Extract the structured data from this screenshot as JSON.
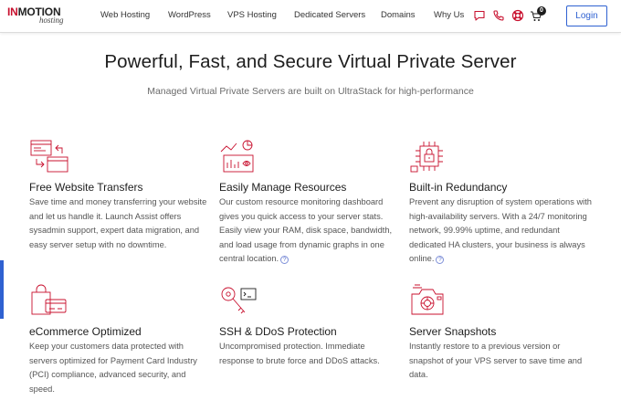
{
  "brand": {
    "logo_main": "INMOTION",
    "logo_in": "IN",
    "logo_rest": "MOTION",
    "logo_sub": "hosting",
    "accent": "#c8102e",
    "link_blue": "#2f61d1"
  },
  "nav": {
    "items": [
      {
        "label": "Web Hosting"
      },
      {
        "label": "WordPress"
      },
      {
        "label": "VPS Hosting"
      },
      {
        "label": "Dedicated Servers"
      },
      {
        "label": "Domains"
      },
      {
        "label": "Why Us"
      }
    ],
    "icons": [
      "chat-icon",
      "phone-icon",
      "lifebuoy-icon",
      "cart-icon"
    ],
    "cart_count": "0",
    "login_label": "Login"
  },
  "hero": {
    "title": "Powerful, Fast, and Secure Virtual Private Server",
    "subtitle": "Managed Virtual Private Servers are built on UltraStack for high-performance"
  },
  "features": [
    {
      "title": "Free Website Transfers",
      "desc": "Save time and money transferring your website and let us handle it. Launch Assist offers sysadmin support, expert data migration, and easy server setup with no downtime.",
      "icon": "website-transfer-icon",
      "help": false
    },
    {
      "title": "Easily Manage Resources",
      "desc": "Our custom resource monitoring dashboard gives you quick access to your server stats. Easily view your RAM, disk space, bandwidth, and load usage from dynamic graphs in one central location.",
      "icon": "resource-graph-icon",
      "help": true
    },
    {
      "title": "Built-in Redundancy",
      "desc": "Prevent any disruption of system operations with high-availability servers. With a 24/7 monitoring network, 99.99% uptime, and redundant dedicated HA clusters, your business is always online.",
      "icon": "redundancy-chip-icon",
      "help": true
    },
    {
      "title": "eCommerce Optimized",
      "desc": "Keep your customers data protected with servers optimized for Payment Card Industry (PCI) compliance, advanced security, and speed.",
      "icon": "shopping-bag-card-icon",
      "help": false
    },
    {
      "title": "SSH & DDoS Protection",
      "desc": "Uncompromised protection. Immediate response to brute force and DDoS attacks.",
      "icon": "key-terminal-icon",
      "help": false
    },
    {
      "title": "Server Snapshots",
      "desc": "Instantly restore to a previous version or snapshot of your VPS server to save time and data.",
      "icon": "camera-snapshot-icon",
      "help": false
    }
  ],
  "help_glyph": "?"
}
